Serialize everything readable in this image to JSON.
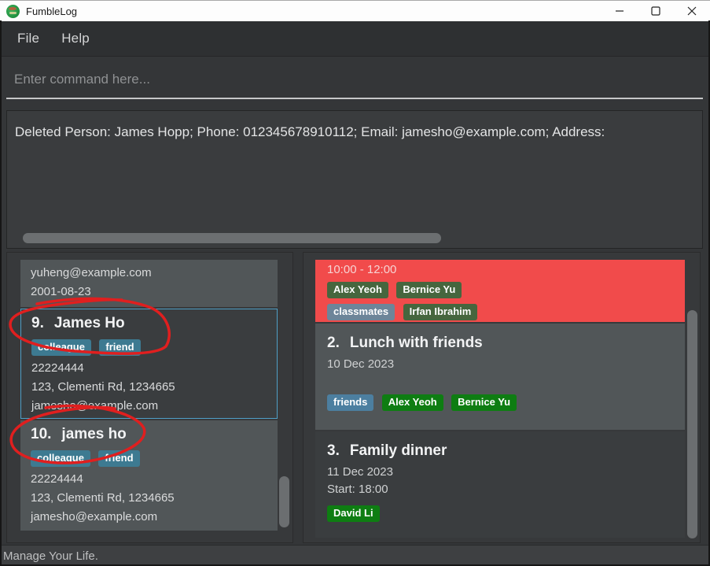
{
  "window": {
    "title": "FumbleLog"
  },
  "menu": {
    "items": [
      {
        "label": "File"
      },
      {
        "label": "Help"
      }
    ]
  },
  "command": {
    "placeholder": "Enter command here...",
    "value": ""
  },
  "result": {
    "text": "Deleted Person: James Hopp; Phone: 012345678910112; Email: jamesho@example.com; Address:"
  },
  "person_list": {
    "items": [
      {
        "email": "yuheng@example.com",
        "birthday": "2001-08-23"
      },
      {
        "index": "9.",
        "name": "James Ho",
        "tags": [
          "colleague",
          "friend"
        ],
        "phone": "22224444",
        "address": "123, Clementi Rd, 1234665",
        "email": "jamesho@example.com",
        "selected": true
      },
      {
        "index": "10.",
        "name": "james ho",
        "tags": [
          "colleague",
          "friend"
        ],
        "phone": "22224444",
        "address": "123, Clementi Rd, 1234665",
        "email": "jamesho@example.com",
        "selected": false
      }
    ]
  },
  "event_list": {
    "items": [
      {
        "time": "10:00 - 12:00",
        "tags": [
          "Alex Yeoh",
          "Bernice Yu",
          "classmates",
          "Irfan Ibrahim"
        ],
        "selected": true
      },
      {
        "index": "2.",
        "title": "Lunch with friends",
        "date": "10 Dec 2023",
        "tags": [
          "friends",
          "Alex Yeoh",
          "Bernice Yu"
        ]
      },
      {
        "index": "3.",
        "title": "Family dinner",
        "date": "11 Dec 2023",
        "start": "Start: 18:00",
        "tags": [
          "David Li"
        ]
      }
    ]
  },
  "statusbar": {
    "text": "Manage Your Life."
  },
  "icons": {
    "app": "fumblelog-logo",
    "minimize": "minimize-icon",
    "maximize": "maximize-icon",
    "close": "close-icon"
  },
  "colors": {
    "accent_red": "#f14b4b",
    "tag_blue": "#3d7a91",
    "group_tag_blue": "#4c7fa0",
    "group_tag_blue_muted": "#6d8599",
    "person_tag_green": "#0e7d12",
    "person_tag_green_muted": "#46663e",
    "selected_border": "#4f9fc6",
    "annotation_red": "#e01f1f"
  }
}
